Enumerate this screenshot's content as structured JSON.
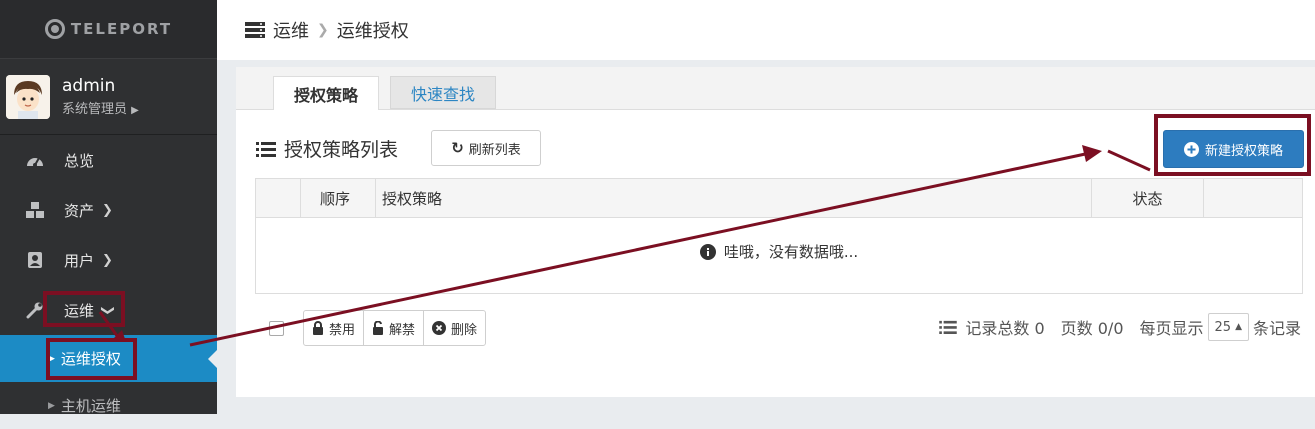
{
  "brand": {
    "name": "TELEPORT"
  },
  "user": {
    "name": "admin",
    "role": "系统管理员"
  },
  "sidebar": {
    "items": [
      {
        "label": "总览",
        "icon": "dashboard-icon"
      },
      {
        "label": "资产",
        "icon": "cubes-icon"
      },
      {
        "label": "用户",
        "icon": "address-book-icon"
      },
      {
        "label": "运维",
        "icon": "wrench-icon"
      }
    ],
    "subitems": [
      {
        "label": "运维授权",
        "active": true
      },
      {
        "label": "主机运维",
        "active": false
      }
    ]
  },
  "header": {
    "section": "运维",
    "page": "运维授权"
  },
  "tabs": [
    {
      "label": "授权策略"
    },
    {
      "label": "快速查找"
    }
  ],
  "list": {
    "title": "授权策略列表",
    "refresh_label": "刷新列表",
    "new_label": "新建授权策略"
  },
  "table": {
    "columns": [
      "顺序",
      "授权策略",
      "状态"
    ],
    "empty_text": "哇哦，没有数据哦..."
  },
  "actions": {
    "disable": "禁用",
    "enable": "解禁",
    "delete": "删除"
  },
  "pager": {
    "total_label": "记录总数 0",
    "pages_label": "页数 0/0",
    "per_page_label": "每页显示",
    "per_page_value": "25",
    "suffix": "条记录"
  },
  "colors": {
    "sidebar": "#2f3032",
    "active": "#1c8bc5",
    "primary": "#2d7cbf",
    "annotation": "#7b0f22"
  }
}
